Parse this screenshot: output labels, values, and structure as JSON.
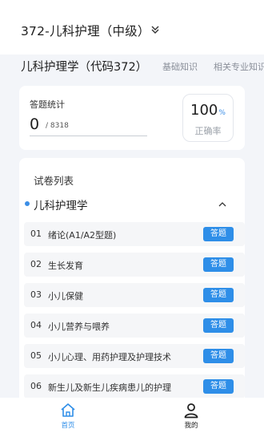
{
  "header": {
    "exam_title": "372-儿科护理（中级）",
    "chevron_icon": "chevron-double-down-icon"
  },
  "subject_bar": {
    "subject_name": "儿科护理学（代码372）",
    "tabs": [
      {
        "label": "基础知识"
      },
      {
        "label": "相关专业知识"
      }
    ]
  },
  "stats": {
    "label": "答题统计",
    "answered": "0",
    "total": "/ 8318",
    "accuracy_value": "100",
    "accuracy_unit": "%",
    "accuracy_label": "正确率"
  },
  "paper_list": {
    "title": "试卷列表",
    "group_name": "儿科护理学",
    "collapse_icon": "chevron-up-icon",
    "chapters": [
      {
        "num": "01",
        "name": "绪论(A1/A2型题)",
        "button": "答题"
      },
      {
        "num": "02",
        "name": "生长发育",
        "button": "答题"
      },
      {
        "num": "03",
        "name": "小儿保健",
        "button": "答题"
      },
      {
        "num": "04",
        "name": "小儿营养与喂养",
        "button": "答题"
      },
      {
        "num": "05",
        "name": "小儿心理、用药护理及护理技术",
        "button": "答题"
      },
      {
        "num": "06",
        "name": "新生儿及新生儿疾病患儿的护理",
        "button": "答题"
      }
    ]
  },
  "bottom_nav": {
    "items": [
      {
        "label": "首页",
        "icon": "home-icon",
        "active": true
      },
      {
        "label": "我的",
        "icon": "user-icon",
        "active": false
      }
    ]
  },
  "colors": {
    "accent": "#2e8ee8",
    "inactive": "#222222"
  }
}
